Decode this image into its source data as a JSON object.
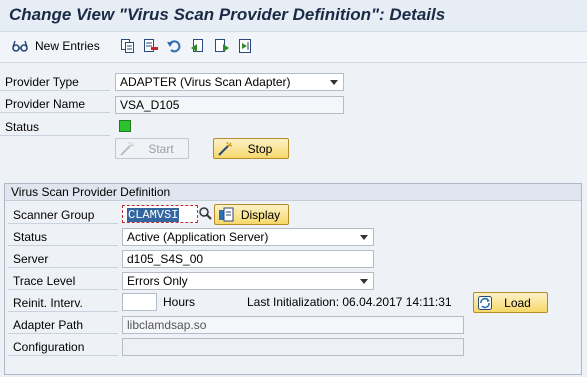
{
  "window": {
    "title": "Change View \"Virus Scan Provider Definition\": Details"
  },
  "toolbar": {
    "new_entries_label": "New Entries"
  },
  "provider": {
    "type_label": "Provider Type",
    "type_value": "ADAPTER (Virus Scan Adapter)",
    "name_label": "Provider Name",
    "name_value": "VSA_D105",
    "status_label": "Status",
    "status_color": "#2ec12e",
    "start_label": "Start",
    "stop_label": "Stop"
  },
  "definition": {
    "group_title": "Virus Scan Provider Definition",
    "scanner_group_label": "Scanner Group",
    "scanner_group_value": "CLAMVSI",
    "display_label": "Display",
    "status_label": "Status",
    "status_value": "Active (Application Server)",
    "server_label": "Server",
    "server_value": "d105_S4S_00",
    "trace_level_label": "Trace Level",
    "trace_level_value": "Errors Only",
    "reinit_label": "Reinit. Interv.",
    "reinit_value": "",
    "hours_label": "Hours",
    "last_init_text": "Last Initialization: 06.04.2017 14:11:31",
    "load_label": "Load",
    "adapter_path_label": "Adapter Path",
    "adapter_path_value": "libclamdsap.so",
    "configuration_label": "Configuration",
    "configuration_value": ""
  },
  "icons": [
    "glasses-icon",
    "copy-icon",
    "delete-icon",
    "undo-icon",
    "previous-entry-icon",
    "next-entry-icon",
    "select-all-icon",
    "search-help-icon",
    "display-icon",
    "start-icon",
    "stop-icon",
    "load-icon"
  ]
}
